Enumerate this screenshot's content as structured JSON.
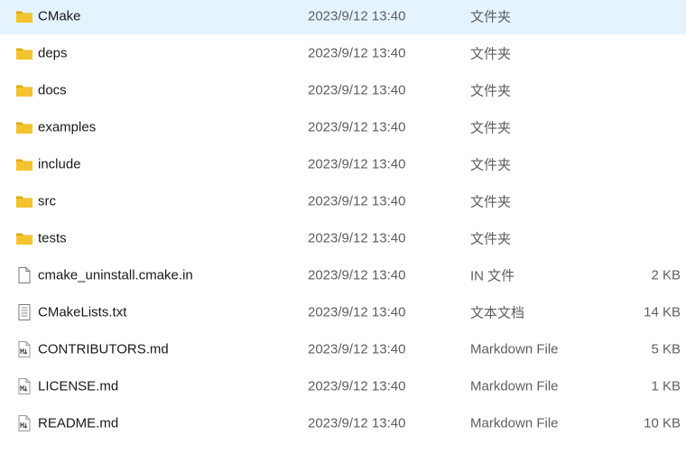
{
  "files": [
    {
      "name": "CMake",
      "modified": "2023/9/12 13:40",
      "type": "文件夹",
      "size": "",
      "icon": "folder-icon"
    },
    {
      "name": "deps",
      "modified": "2023/9/12 13:40",
      "type": "文件夹",
      "size": "",
      "icon": "folder-icon"
    },
    {
      "name": "docs",
      "modified": "2023/9/12 13:40",
      "type": "文件夹",
      "size": "",
      "icon": "folder-icon"
    },
    {
      "name": "examples",
      "modified": "2023/9/12 13:40",
      "type": "文件夹",
      "size": "",
      "icon": "folder-icon"
    },
    {
      "name": "include",
      "modified": "2023/9/12 13:40",
      "type": "文件夹",
      "size": "",
      "icon": "folder-icon"
    },
    {
      "name": "src",
      "modified": "2023/9/12 13:40",
      "type": "文件夹",
      "size": "",
      "icon": "folder-icon"
    },
    {
      "name": "tests",
      "modified": "2023/9/12 13:40",
      "type": "文件夹",
      "size": "",
      "icon": "folder-icon"
    },
    {
      "name": "cmake_uninstall.cmake.in",
      "modified": "2023/9/12 13:40",
      "type": "IN 文件",
      "size": "2 KB",
      "icon": "blank-file-icon"
    },
    {
      "name": "CMakeLists.txt",
      "modified": "2023/9/12 13:40",
      "type": "文本文档",
      "size": "14 KB",
      "icon": "text-file-icon"
    },
    {
      "name": "CONTRIBUTORS.md",
      "modified": "2023/9/12 13:40",
      "type": "Markdown File",
      "size": "5 KB",
      "icon": "markdown-file-icon"
    },
    {
      "name": "LICENSE.md",
      "modified": "2023/9/12 13:40",
      "type": "Markdown File",
      "size": "1 KB",
      "icon": "markdown-file-icon"
    },
    {
      "name": "README.md",
      "modified": "2023/9/12 13:40",
      "type": "Markdown File",
      "size": "10 KB",
      "icon": "markdown-file-icon"
    }
  ],
  "colors": {
    "folder": "#f4c430",
    "folder_dark": "#e0a800",
    "row_hover": "#e5f3ff",
    "secondary_text": "#5f5f5f"
  }
}
